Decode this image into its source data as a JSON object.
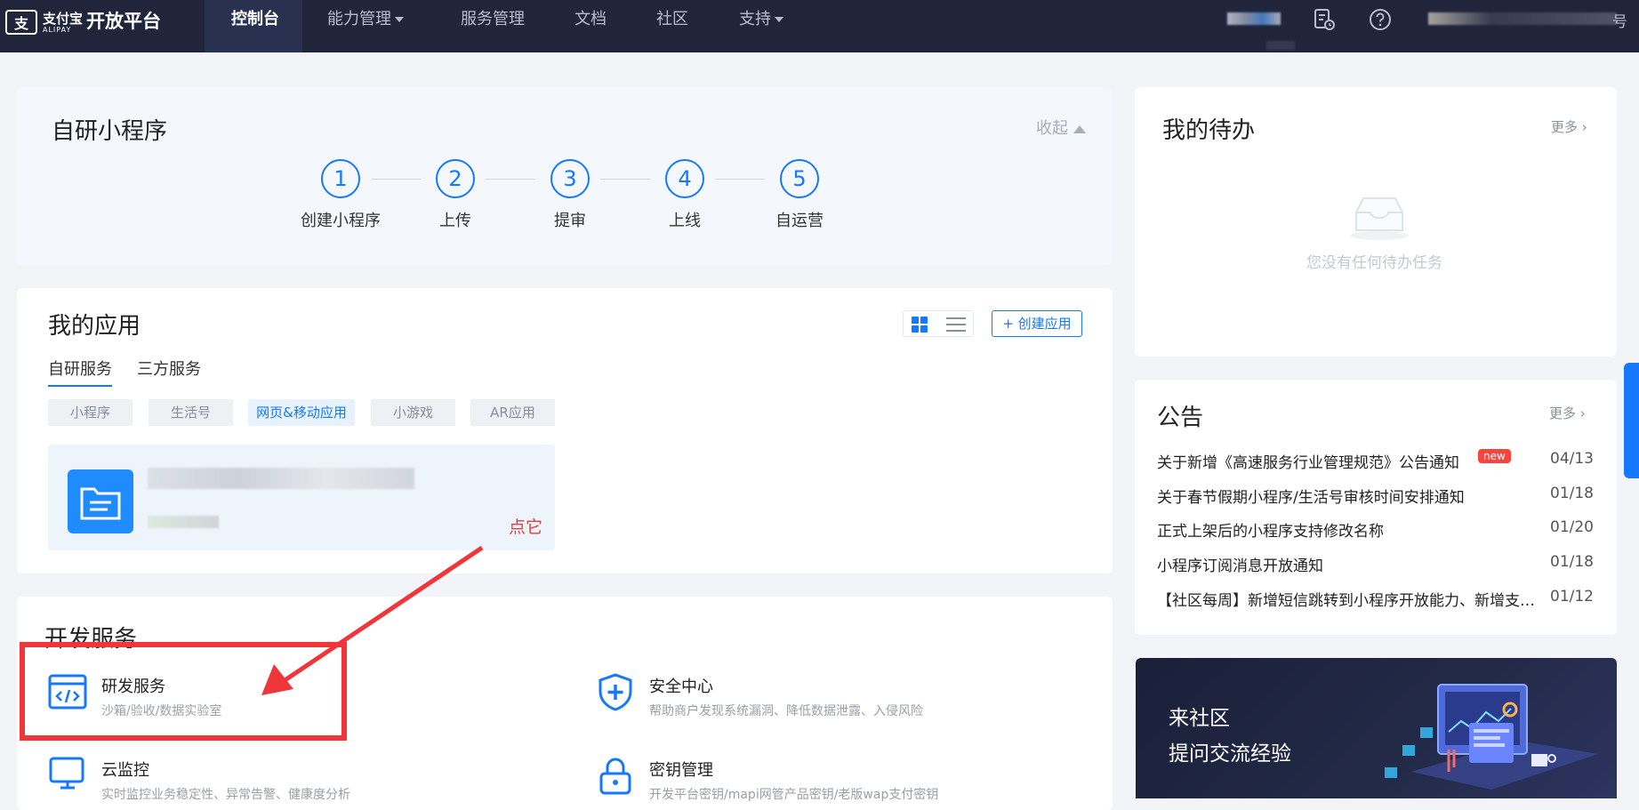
{
  "header": {
    "logo_cn": "支付宝",
    "logo_en": "ALIPAY",
    "platform_title": "开放平台",
    "nav": [
      {
        "label": "控制台"
      },
      {
        "label": "能力管理"
      },
      {
        "label": "服务管理"
      },
      {
        "label": "文档"
      },
      {
        "label": "社区"
      },
      {
        "label": "支持"
      }
    ],
    "icons": [
      "document-clock-icon",
      "help-icon"
    ],
    "account_suffix": "号"
  },
  "mini_program": {
    "title": "自研小程序",
    "collapse_label": "收起",
    "steps": [
      {
        "num": "1",
        "label": "创建小程序"
      },
      {
        "num": "2",
        "label": "上传"
      },
      {
        "num": "3",
        "label": "提审"
      },
      {
        "num": "4",
        "label": "上线"
      },
      {
        "num": "5",
        "label": "自运营"
      }
    ]
  },
  "my_apps": {
    "title": "我的应用",
    "create_label": "+ 创建应用",
    "tabs": [
      {
        "label": "自研服务"
      },
      {
        "label": "三方服务"
      }
    ],
    "chips": [
      {
        "label": "小程序"
      },
      {
        "label": "生活号"
      },
      {
        "label": "网页&移动应用"
      },
      {
        "label": "小游戏"
      },
      {
        "label": "AR应用"
      }
    ],
    "click_tip": "点它"
  },
  "dev_services": {
    "title": "开发服务",
    "items": [
      {
        "name": "研发服务",
        "desc": "沙箱/验收/数据实验室"
      },
      {
        "name": "安全中心",
        "desc": "帮助商户发现系统漏洞、降低数据泄露、入侵风险"
      },
      {
        "name": "云监控",
        "desc": "实时监控业务稳定性、异常告警、健康度分析"
      },
      {
        "name": "密钥管理",
        "desc": "开发平台密钥/mapi网管产品密钥/老版wap支付密钥"
      }
    ]
  },
  "todo": {
    "title": "我的待办",
    "more_label": "更多",
    "empty_text": "您没有任何待办任务"
  },
  "notice": {
    "title": "公告",
    "more_label": "更多",
    "badge": "new",
    "items": [
      {
        "title": "关于新增《高速服务行业管理规范》公告通知",
        "date": "04/13"
      },
      {
        "title": "关于春节假期小程序/生活号审核时间安排通知",
        "date": "01/18"
      },
      {
        "title": "正式上架后的小程序支持修改名称",
        "date": "01/20"
      },
      {
        "title": "小程序订阅消息开放通知",
        "date": "01/18"
      },
      {
        "title": "【社区每周】新增短信跳转到小程序开放能力、新增支付宝小程序跳转能力",
        "date": "01/12"
      }
    ]
  },
  "community": {
    "line1": "来社区",
    "line2": "提问交流经验"
  },
  "colors": {
    "topbar": "#20253c",
    "accent": "#1677ff",
    "highlight_red": "#f0353b"
  }
}
